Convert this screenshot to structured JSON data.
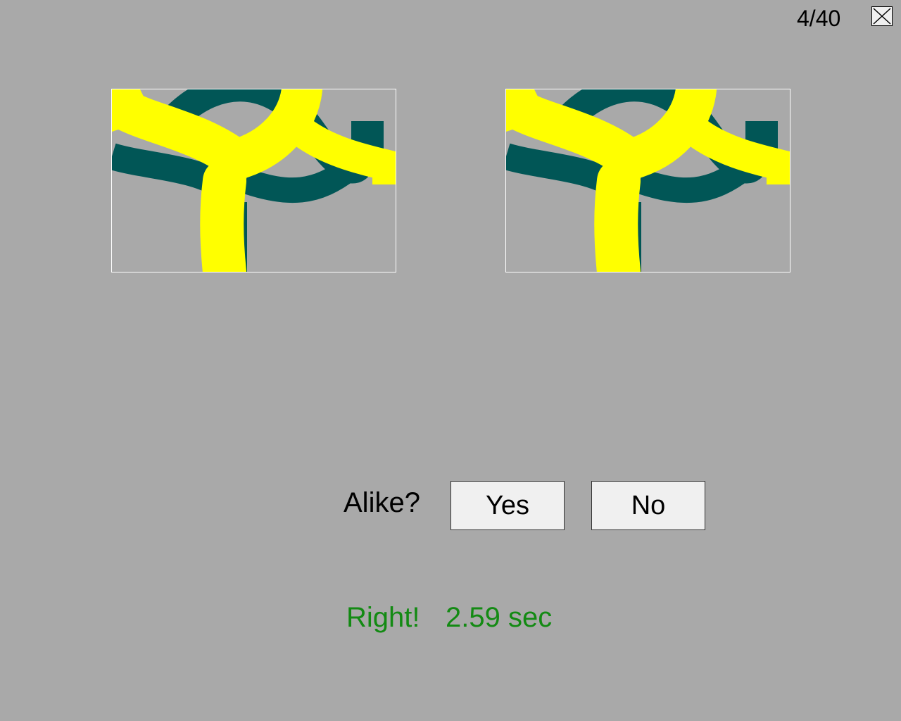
{
  "trial_counter": "4/40",
  "close_icon": "close-x-icon",
  "stimuli": {
    "left": {
      "shape_color": "#ffff00",
      "background_shape_color": "#015656"
    },
    "right": {
      "shape_color": "#ffff00",
      "background_shape_color": "#015656"
    }
  },
  "prompt": {
    "question": "Alike?",
    "yes_label": "Yes",
    "no_label": "No"
  },
  "feedback": {
    "result": "Right!",
    "time": "2.59 sec",
    "color": "#138a13"
  },
  "colors": {
    "background": "#a9a9a9",
    "button_face": "#f0f0f0"
  }
}
